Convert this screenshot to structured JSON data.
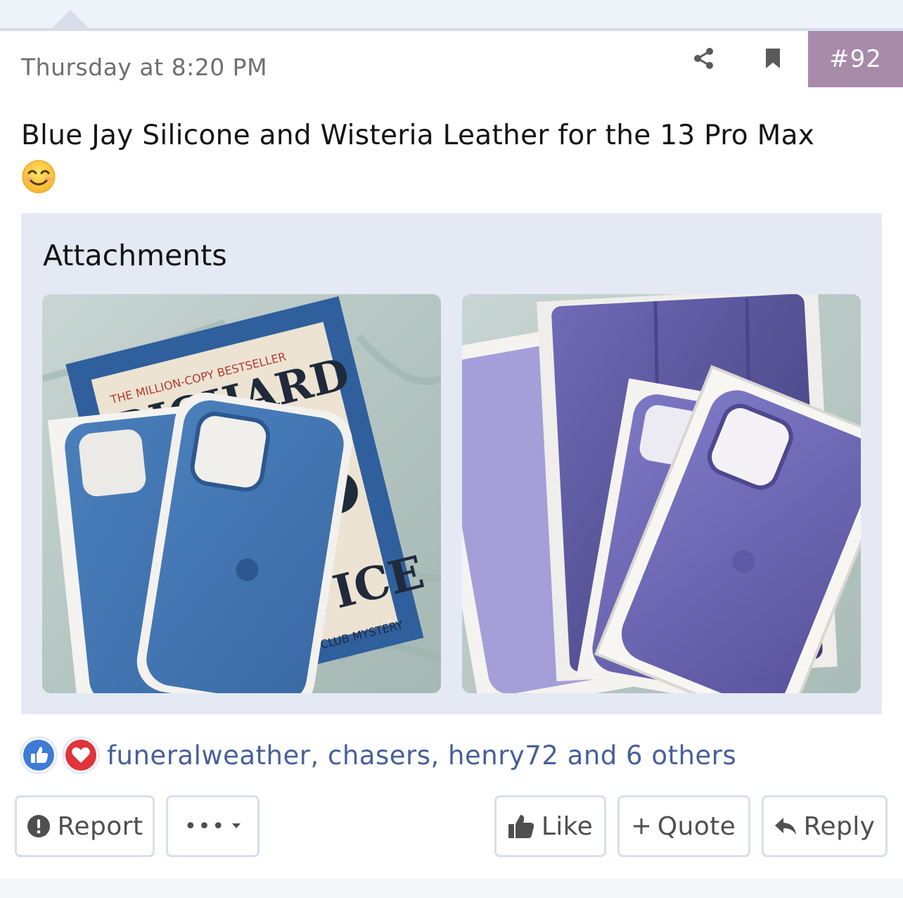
{
  "post": {
    "date": "Thursday at 8:20 PM",
    "number": "#92",
    "message": "Blue Jay Silicone and Wisteria Leather for the 13 Pro Max",
    "emoji": "smiling-face-icon"
  },
  "attachments": {
    "title": "Attachments",
    "items": [
      {
        "name": "blue-jay-silicone-case-photo"
      },
      {
        "name": "wisteria-leather-case-photo"
      }
    ]
  },
  "reactions": {
    "icons": [
      "like-icon",
      "love-icon"
    ],
    "summary": "funeralweather, chasers, henry72 and 6 others"
  },
  "actions": {
    "report": "Report",
    "more": "•••",
    "like": "Like",
    "quote": "Quote",
    "reply": "Reply"
  },
  "colors": {
    "post_number_bg": "#a88ba8",
    "attachments_bg": "#e4e9f3",
    "link": "#47609a",
    "like_blue": "#3d7bd6",
    "love_red": "#e0343a"
  }
}
